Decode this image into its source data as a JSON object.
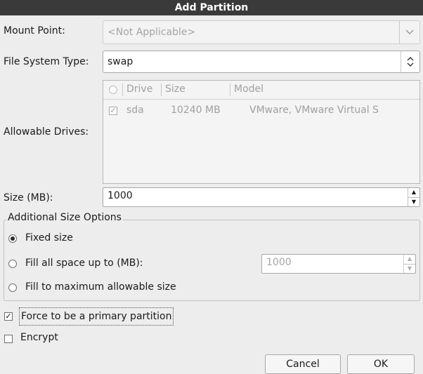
{
  "window": {
    "title": "Add Partition"
  },
  "mount_point": {
    "label": "Mount Point:",
    "value": "<Not Applicable>"
  },
  "fs_type": {
    "label": "File System Type:",
    "value": "swap"
  },
  "drives": {
    "label": "Allowable Drives:",
    "columns": [
      "Drive",
      "Size",
      "Model"
    ],
    "rows": [
      {
        "checked": true,
        "drive": "sda",
        "size": "10240 MB",
        "model": "VMware, VMware Virtual S"
      }
    ]
  },
  "size": {
    "label": "Size (MB):",
    "value": "1000"
  },
  "options": {
    "title": "Additional Size Options",
    "fixed": "Fixed size",
    "fill_upto": "Fill all space up to (MB):",
    "fill_upto_value": "1000",
    "fill_max": "Fill to maximum allowable size",
    "selected": "fixed"
  },
  "primary": {
    "label": "Force to be a primary partition",
    "checked": true
  },
  "encrypt": {
    "label": "Encrypt",
    "checked": false
  },
  "buttons": {
    "cancel": "Cancel",
    "ok": "OK"
  }
}
